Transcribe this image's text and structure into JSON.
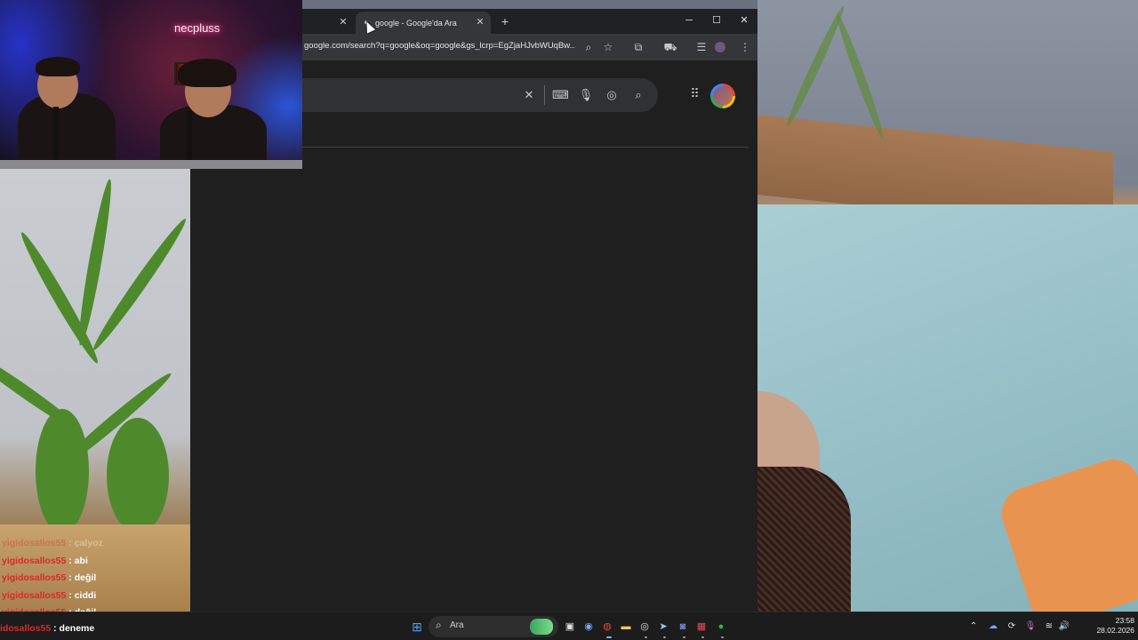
{
  "webcam": {
    "neon_sign": "necpluss"
  },
  "browser": {
    "tabs": [
      {
        "label": ""
      },
      {
        "label": "google - Google'da Ara"
      }
    ],
    "url": "google.com/search?q=google&oq=google&gs_lcrp=EgZjaHJvbWUqBw...",
    "icons": {
      "tab_close": "✕",
      "new_tab": "+",
      "minimize": "─",
      "maximize": "☐",
      "close": "✕",
      "zoom": "⌕",
      "bookmark": "☆",
      "extensions": "⧉",
      "incognito": "⛟",
      "media": "☰",
      "menu": "⋮",
      "clear": "✕",
      "keyboard": "⌨",
      "mic": "🎙",
      "lens": "◎",
      "search": "⌕",
      "apps": "⋮⋮⋮"
    }
  },
  "chat": {
    "messages": [
      {
        "user": "yigidosallos55",
        "text": "çalyoz",
        "faded": true
      },
      {
        "user": "yigidosallos55",
        "text": "abi"
      },
      {
        "user": "yigidosallos55",
        "text": "değil"
      },
      {
        "user": "yigidosallos55",
        "text": "ciddi"
      },
      {
        "user": "yigidosallos55",
        "text": "değil"
      },
      {
        "user": "idosallos55",
        "text": "deneme"
      }
    ],
    "separator": " : "
  },
  "taskbar": {
    "search_label": "Ara",
    "start_icon": "⊞",
    "search_icon": "⌕",
    "time": "23:58",
    "date": "28.02.2026",
    "tray": {
      "chevron": "⌃",
      "mic": "🎙",
      "wifi": "≋",
      "volume": "🔊"
    }
  },
  "colors": {
    "username": "#d92a2a",
    "chrome_bg": "#202124",
    "taskbar_bg": "#1c1c1c"
  }
}
